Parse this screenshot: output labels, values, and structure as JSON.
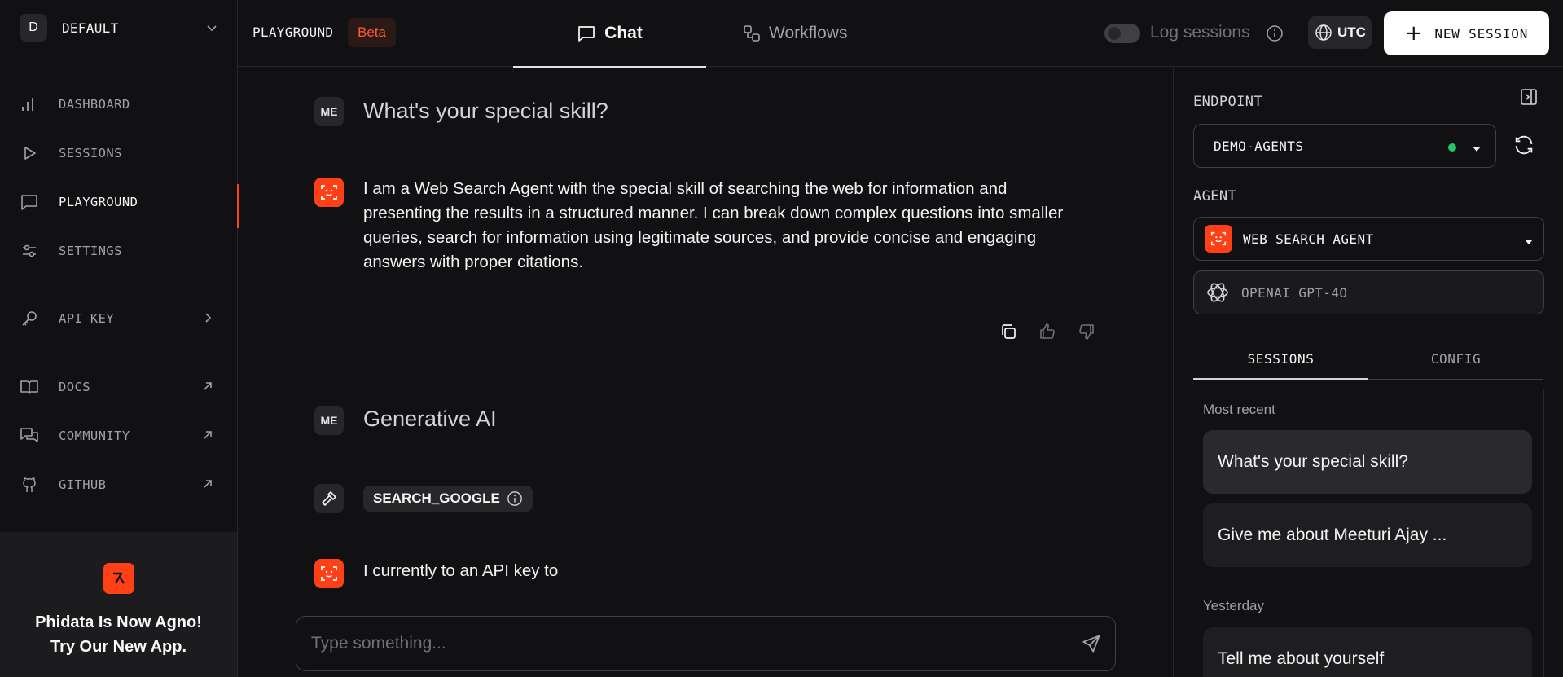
{
  "sidebar": {
    "workspace": {
      "initial": "D",
      "name": "DEFAULT"
    },
    "items": [
      {
        "label": "DASHBOARD",
        "icon": "bar-chart-icon"
      },
      {
        "label": "SESSIONS",
        "icon": "play-icon"
      },
      {
        "label": "PLAYGROUND",
        "icon": "chat-icon",
        "active": true
      },
      {
        "label": "SETTINGS",
        "icon": "sliders-icon"
      },
      {
        "label": "API KEY",
        "icon": "key-icon"
      },
      {
        "label": "DOCS",
        "icon": "book-icon"
      },
      {
        "label": "COMMUNITY",
        "icon": "messages-icon"
      },
      {
        "label": "GITHUB",
        "icon": "github-icon"
      }
    ],
    "promo": {
      "line1": "Phidata Is Now Agno!",
      "line2": "Try Our New App."
    }
  },
  "header": {
    "title": "PLAYGROUND",
    "badge": "Beta",
    "tabs": [
      {
        "label": "Chat",
        "active": true
      },
      {
        "label": "Workflows",
        "active": false
      }
    ],
    "log_sessions_label": "Log sessions",
    "log_sessions_on": false,
    "timezone": "UTC",
    "new_session_label": "NEW SESSION"
  },
  "chat": {
    "messages": [
      {
        "role": "user",
        "avatar": "ME",
        "text": "What's your special skill?"
      },
      {
        "role": "agent",
        "text": "I am a Web Search Agent with the special skill of searching the web for information and presenting the results in a structured manner. I can break down complex questions into smaller queries, search for information using legitimate sources, and provide concise and engaging answers with proper citations."
      },
      {
        "role": "user",
        "avatar": "ME",
        "text": "Generative AI"
      },
      {
        "role": "tool",
        "tool_name": "SEARCH_GOOGLE"
      },
      {
        "role": "agent",
        "text": "I currently to an API key to"
      }
    ],
    "composer_placeholder": "Type something..."
  },
  "panel": {
    "endpoint_label": "ENDPOINT",
    "endpoint_value": "DEMO-AGENTS",
    "endpoint_status_color": "#22c55e",
    "agent_label": "AGENT",
    "agent_value": "WEB SEARCH AGENT",
    "model_value": "OPENAI GPT-4O",
    "tabs": [
      {
        "label": "SESSIONS",
        "active": true
      },
      {
        "label": "CONFIG",
        "active": false
      }
    ],
    "groups": [
      {
        "label": "Most recent",
        "sessions": [
          "What's your special skill?",
          "Give me about Meeturi Ajay ..."
        ]
      },
      {
        "label": "Yesterday",
        "sessions": [
          "Tell me about yourself"
        ]
      }
    ]
  },
  "colors": {
    "accent": "#ff4017",
    "background": "#111113",
    "surface": "#27272a"
  }
}
